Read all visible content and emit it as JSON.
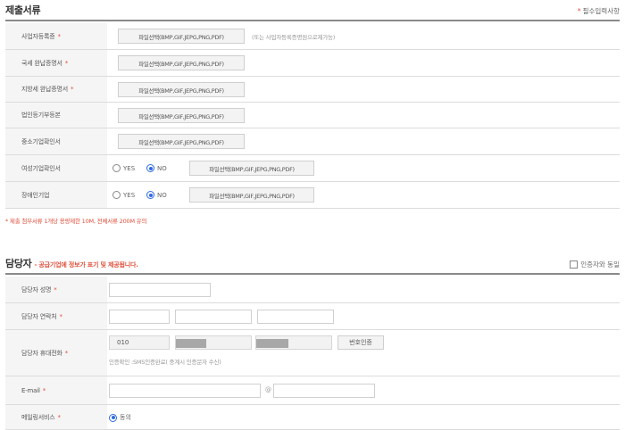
{
  "documents": {
    "title": "제출서류",
    "required_star": "*",
    "required_note": "필수입력사항",
    "file_button": "파일선택(BMP,GIF,JEPG,PNG,PDF)",
    "biz_reg_hint": "(또는 사업자등록증명원으로제가능)",
    "rows": [
      {
        "label": "사업자등록증",
        "required": true
      },
      {
        "label": "국세 완납증명서",
        "required": true
      },
      {
        "label": "지방세 완납증명서",
        "required": true
      },
      {
        "label": "법인등기부등본",
        "required": false
      },
      {
        "label": "중소기업확인서",
        "required": false
      },
      {
        "label": "여성기업확인서",
        "required": false
      },
      {
        "label": "장애인기업",
        "required": false
      }
    ],
    "yes_label": "YES",
    "no_label": "NO",
    "size_note": "* 제출 첨부서류 1개당 용량제한 10M, 전체서류 200M 유의"
  },
  "contact": {
    "title": "담당자",
    "subtitle": "- 공급기업에 정보가 표기 및 제공됩니다.",
    "same_as_cert": "인증자와 동일",
    "rows": [
      {
        "label": "담당자 성명",
        "required": true
      },
      {
        "label": "담당자 연락처",
        "required": true
      },
      {
        "label": "담당자 휴대전화",
        "required": true
      },
      {
        "label": "E-mail",
        "required": true
      },
      {
        "label": "메일링서비스",
        "required": true
      }
    ],
    "mobile_prefix": "010",
    "verify_button": "번호인증",
    "sms_hint": "인증확인 :SMS인증완료( 중계시 인증문자 수신)",
    "at_sign": "@",
    "mailing_agree": "동의"
  },
  "colors": {
    "accent_red": "#e0503c",
    "radio_blue": "#2f6be0",
    "label_bg": "#f5f5f5"
  }
}
